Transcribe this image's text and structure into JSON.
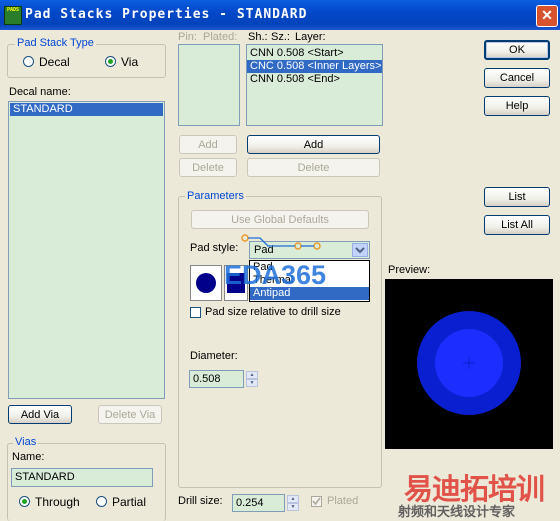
{
  "window": {
    "title": "Pad Stacks Properties - STANDARD",
    "app_icon_text": "PADS",
    "close_glyph": "✕"
  },
  "pad_stack_type": {
    "legend": "Pad Stack Type",
    "decal_label": "Decal",
    "via_label": "Via",
    "selected": "via"
  },
  "decal_name": {
    "label": "Decal name:",
    "items": [
      "STANDARD"
    ],
    "selected_index": 0
  },
  "layers": {
    "pin_header": "Pin:",
    "plated_header": "Plated:",
    "sh_header": "Sh.:",
    "sz_header": "Sz.:",
    "layer_header": "Layer:",
    "rows": [
      "CNN 0.508 <Start>",
      "CNC 0.508 <Inner Layers>",
      "CNN 0.508 <End>"
    ],
    "selected_index": 1
  },
  "left_buttons": {
    "add": "Add",
    "delete": "Delete"
  },
  "right_buttons": {
    "add": "Add",
    "delete": "Delete"
  },
  "dialog_buttons": {
    "ok": "OK",
    "cancel": "Cancel",
    "help": "Help",
    "list": "List",
    "list_all": "List All"
  },
  "parameters": {
    "legend": "Parameters",
    "use_global_defaults": "Use Global Defaults",
    "pad_style_label": "Pad style:",
    "pad_style_value": "Pad",
    "pad_style_options": [
      "Pad",
      "Thermal",
      "Antipad"
    ],
    "pad_style_selected_index": 2,
    "pad_size_relative_label": "Pad size relative to drill size",
    "diameter_label": "Diameter:",
    "diameter_value": "0.508"
  },
  "preview": {
    "label": "Preview:"
  },
  "via_buttons": {
    "add_via": "Add Via",
    "delete_via": "Delete Via"
  },
  "vias": {
    "legend": "Vias",
    "name_label": "Name:",
    "name_value": "STANDARD",
    "through_label": "Through",
    "partial_label": "Partial",
    "selected": "through"
  },
  "drill": {
    "label": "Drill size:",
    "value": "0.254",
    "plated_label": "Plated"
  },
  "watermark": {
    "eda_text": "EDA365",
    "cn_title": "易迪拓培训",
    "cn_subtitle": "射频和天线设计专家"
  },
  "colors": {
    "listbox_bg": "#D9ECD8",
    "selection": "#316AC5",
    "titlebar": "#0348C9",
    "pad_outer": "#0A1FD0",
    "pad_inner": "#1B2EFF",
    "accent_text": "#0046D5"
  }
}
